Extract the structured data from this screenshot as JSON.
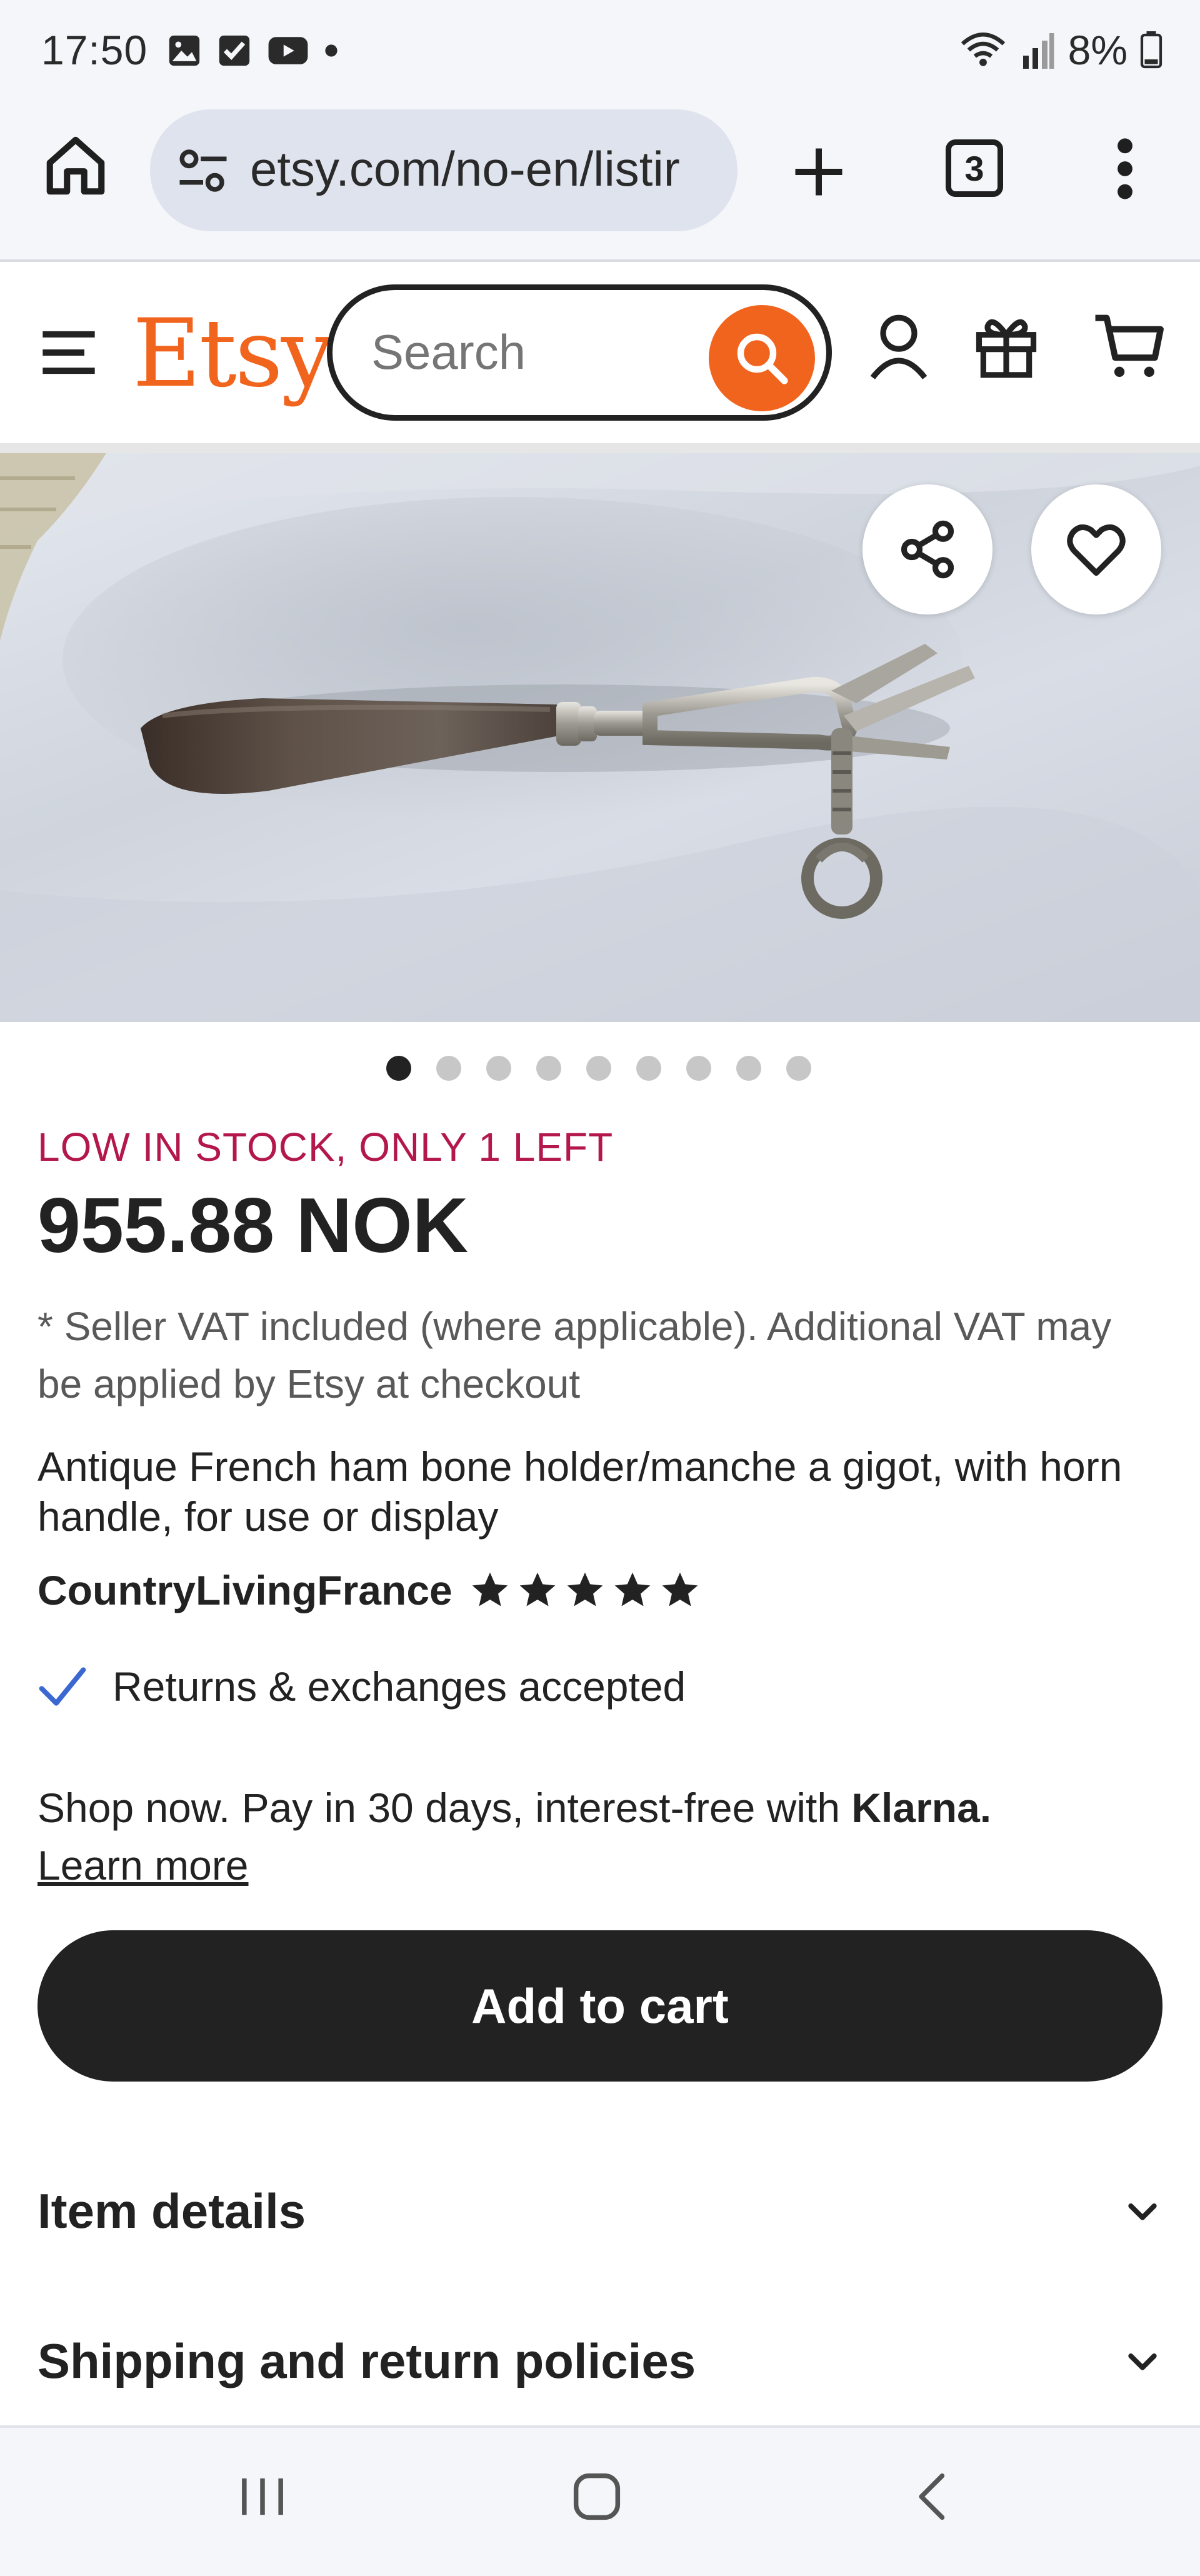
{
  "status_bar": {
    "time": "17:50",
    "icons_left": [
      "image-icon",
      "checkbox-icon",
      "youtube-icon",
      "dot-icon"
    ],
    "icons_right": [
      "wifi-icon",
      "signal-icon",
      "battery-icon"
    ],
    "battery": "8%"
  },
  "browser": {
    "url": "etsy.com/no-en/listir",
    "tab_count": "3"
  },
  "header": {
    "logo": "Etsy",
    "search_placeholder": "Search"
  },
  "gallery": {
    "image_count": 9,
    "active_index": 0
  },
  "product": {
    "stock_notice": "LOW IN STOCK, ONLY 1 LEFT",
    "price": "955.88 NOK",
    "vat_note": "* Seller VAT included (where applicable). Additional VAT may be applied by Etsy at checkout",
    "title": "Antique French ham bone holder/manche a gigot, with horn handle, for use or display",
    "shop_name": "CountryLivingFrance",
    "rating_stars": 5,
    "returns": "Returns & exchanges accepted",
    "klarna_text": "Shop now. Pay in 30 days, interest-free with ",
    "klarna_brand": "Klarna",
    "klarna_period": ".",
    "learn_more": "Learn more",
    "add_to_cart": "Add to cart"
  },
  "sections": [
    {
      "label": "Item details"
    },
    {
      "label": "Shipping and return policies"
    }
  ],
  "colors": {
    "brand_orange": "#f1641e",
    "stock_red": "#b3174b",
    "button_dark": "#222222",
    "check_blue": "#3b67d0"
  }
}
